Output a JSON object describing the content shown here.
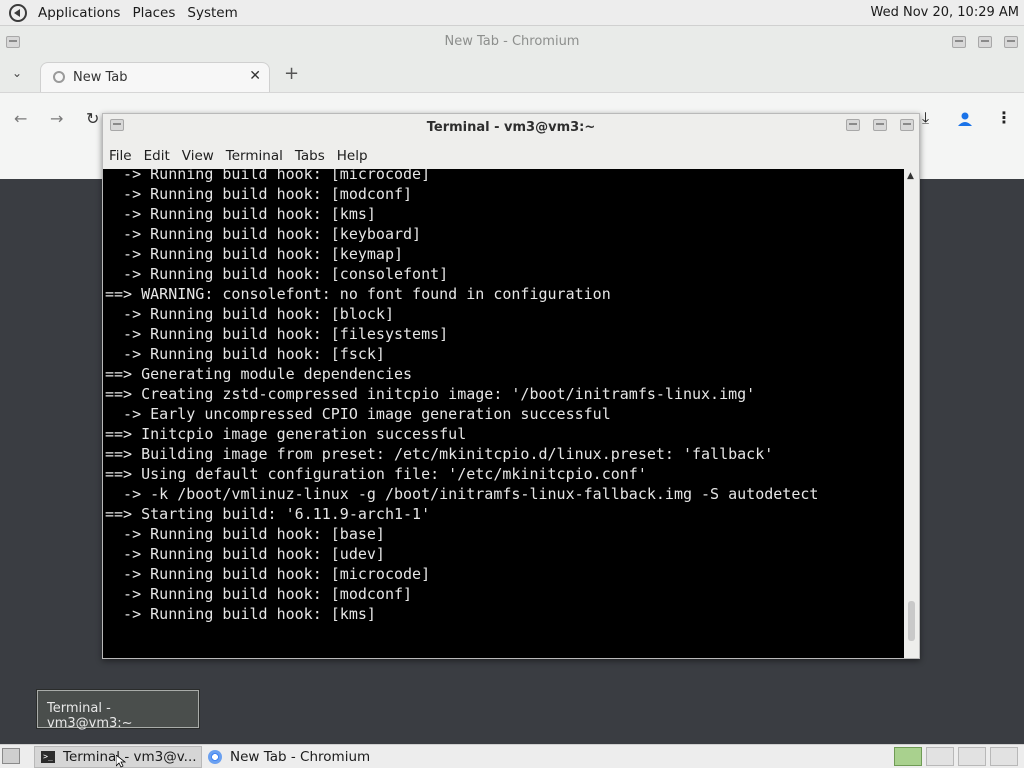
{
  "top_panel": {
    "menus": [
      "Applications",
      "Places",
      "System"
    ],
    "clock": "Wed Nov 20, 10:29 AM"
  },
  "chromium": {
    "window_title": "New Tab - Chromium",
    "tab": {
      "title": "New Tab",
      "close": "✕"
    },
    "new_tab": "+",
    "tab_list": "⌄"
  },
  "terminal": {
    "window_title": "Terminal - vm3@vm3:~",
    "menus": [
      "File",
      "Edit",
      "View",
      "Terminal",
      "Tabs",
      "Help"
    ],
    "lines": [
      "  -> Running build hook: [microcode]",
      "  -> Running build hook: [modconf]",
      "  -> Running build hook: [kms]",
      "  -> Running build hook: [keyboard]",
      "  -> Running build hook: [keymap]",
      "  -> Running build hook: [consolefont]",
      "==> WARNING: consolefont: no font found in configuration",
      "  -> Running build hook: [block]",
      "  -> Running build hook: [filesystems]",
      "  -> Running build hook: [fsck]",
      "==> Generating module dependencies",
      "==> Creating zstd-compressed initcpio image: '/boot/initramfs-linux.img'",
      "  -> Early uncompressed CPIO image generation successful",
      "==> Initcpio image generation successful",
      "==> Building image from preset: /etc/mkinitcpio.d/linux.preset: 'fallback'",
      "==> Using default configuration file: '/etc/mkinitcpio.conf'",
      "  -> -k /boot/vmlinuz-linux -g /boot/initramfs-linux-fallback.img -S autodetect",
      "==> Starting build: '6.11.9-arch1-1'",
      "  -> Running build hook: [base]",
      "  -> Running build hook: [udev]",
      "  -> Running build hook: [microcode]",
      "  -> Running build hook: [modconf]",
      "  -> Running build hook: [kms]"
    ]
  },
  "tooltip": {
    "text": "Terminal - vm3@vm3:~"
  },
  "taskbar": {
    "tasks": [
      {
        "label": "Terminal - vm3@v...",
        "icon": "terminal-icon",
        "active": true
      },
      {
        "label": "New Tab - Chromium",
        "icon": "chromium-icon",
        "active": false
      }
    ],
    "workspaces": 4,
    "active_workspace": 1
  },
  "colors": {
    "terminal_bg": "#000000",
    "terminal_fg": "#e6e6e6",
    "desktop_bg": "#3a3d42",
    "workspace_active": "#a9d18e"
  }
}
